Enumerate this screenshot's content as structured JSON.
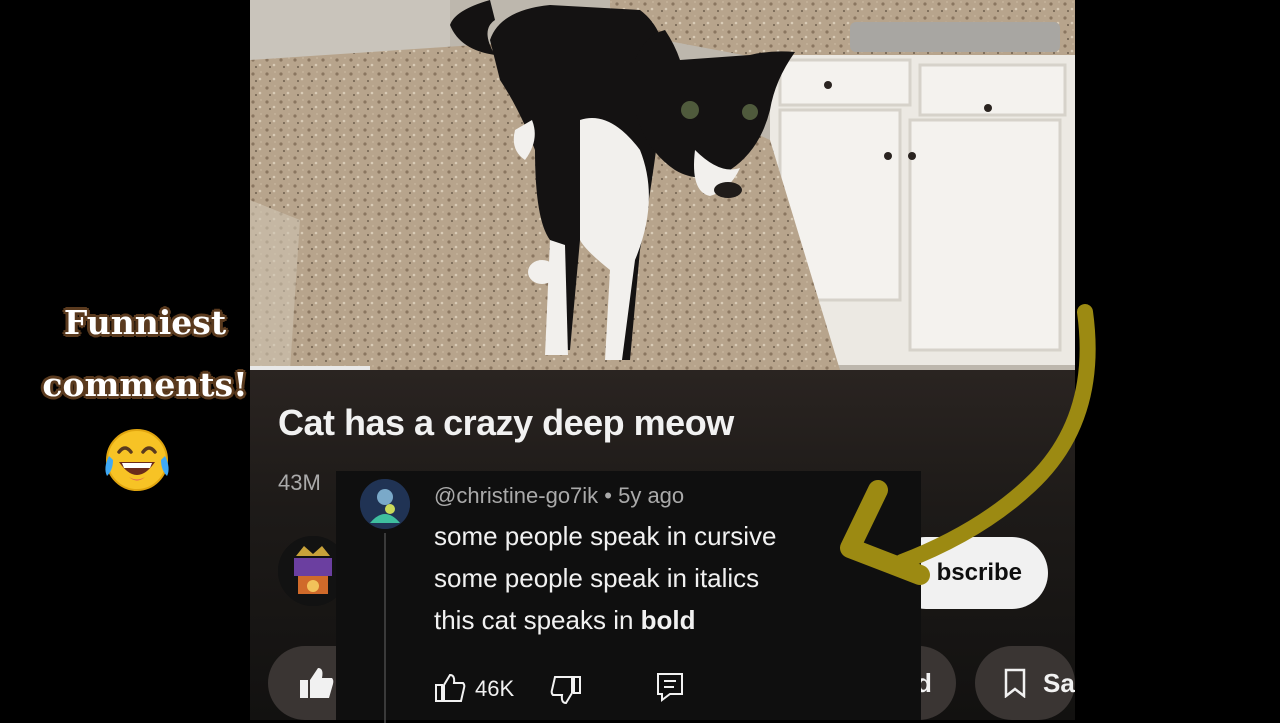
{
  "caption": {
    "line1": "Funniest",
    "line2": "comments!",
    "emoji": "😂"
  },
  "video": {
    "title": "Cat has a crazy deep meow",
    "views": "43M",
    "progress_fraction": 0.15
  },
  "actions": {
    "subscribe_label": "Subscribe",
    "subscribe_visible": "bscribe",
    "download_visible": "d",
    "save_visible": "Sa"
  },
  "comment": {
    "handle": "@christine-go7ik",
    "age": "5y ago",
    "meta": "@christine-go7ik • 5y ago",
    "line1": "some people speak in cursive",
    "line2": "some people speak in italics",
    "line3_prefix": "this cat speaks in ",
    "line3_bold": "bold",
    "likes": "46K"
  },
  "colors": {
    "arrow": "#9c8a12",
    "panel": "#1d1a18",
    "comment_bg": "#0f0f0f",
    "caption_outline": "#5a3a1e"
  },
  "icons": {
    "like": "thumbs-up-icon",
    "dislike": "thumbs-down-icon",
    "reply": "reply-icon",
    "save": "bookmark-icon"
  }
}
